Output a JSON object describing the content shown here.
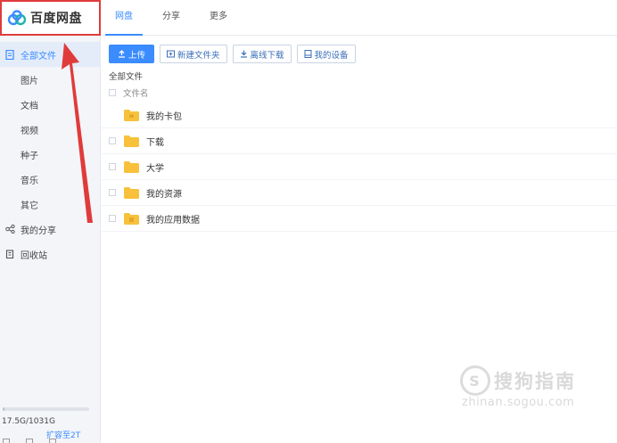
{
  "brand": {
    "name": "百度网盘",
    "colors": {
      "logo_blue": "#3b8cff",
      "logo_teal": "#20b3b0",
      "annotation_red": "#e03b3b"
    }
  },
  "top_nav": [
    {
      "label": "网盘",
      "active": true
    },
    {
      "label": "分享",
      "active": false
    },
    {
      "label": "更多",
      "active": false
    }
  ],
  "sidebar": {
    "items": [
      {
        "label": "全部文件",
        "icon": "file-icon",
        "active": true
      },
      {
        "label": "图片"
      },
      {
        "label": "文档"
      },
      {
        "label": "视频"
      },
      {
        "label": "种子"
      },
      {
        "label": "音乐"
      },
      {
        "label": "其它"
      },
      {
        "label": "我的分享",
        "icon": "share-icon"
      },
      {
        "label": "回收站",
        "icon": "trash-icon"
      }
    ],
    "storage": {
      "text": "17.5G/1031G",
      "used_fraction": 0.017
    },
    "expand_label": "扩容至2T"
  },
  "toolbar": {
    "upload_label": "上传",
    "new_folder_label": "新建文件夹",
    "offline_download_label": "离线下载",
    "my_devices_label": "我的设备"
  },
  "main": {
    "breadcrumb": "全部文件",
    "column_header": "文件名",
    "files": [
      {
        "name": "我的卡包",
        "icon": "card-folder-icon"
      },
      {
        "name": "下载",
        "icon": "folder-icon"
      },
      {
        "name": "大学",
        "icon": "folder-icon"
      },
      {
        "name": "我的资源",
        "icon": "folder-icon"
      },
      {
        "name": "我的应用数据",
        "icon": "app-folder-icon"
      }
    ]
  },
  "watermark": {
    "line1": "搜狗指南",
    "line2": "zhinan.sogou.com"
  }
}
